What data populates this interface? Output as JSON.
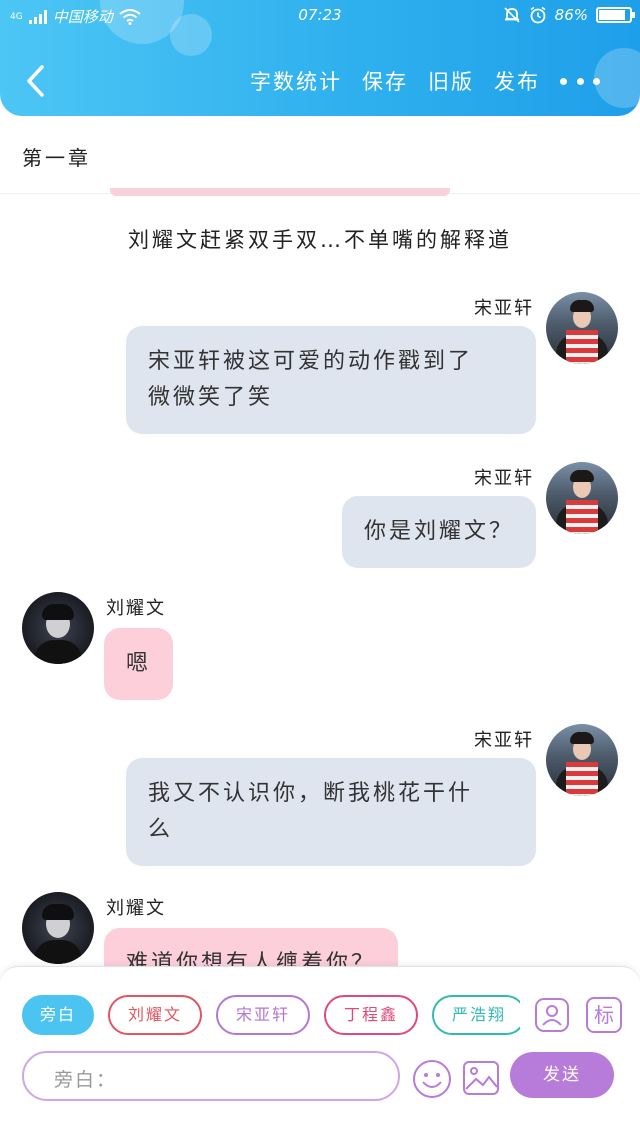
{
  "status_bar": {
    "network": "4G",
    "carrier": "中国移动",
    "time": "07:23",
    "battery_text": "86%",
    "battery_level": 0.86
  },
  "header": {
    "back_icon": "chevron-left-icon",
    "actions": [
      "字数统计",
      "保存",
      "旧版",
      "发布"
    ],
    "more_icon": "more-dots-icon",
    "gradient": [
      "#4cc6f4",
      "#1e9fe9"
    ]
  },
  "chapter": {
    "title": "第一章"
  },
  "messages": {
    "narration": "刘耀文赶紧双手双…不单嘴的解释道",
    "m1": {
      "speaker": "宋亚轩",
      "text": [
        "宋亚轩被这可爱的动作戳到了",
        "微微笑了笑"
      ]
    },
    "m2": {
      "speaker": "宋亚轩",
      "text": [
        "你是刘耀文？"
      ]
    },
    "m3": {
      "speaker": "刘耀文",
      "text": [
        "嗯"
      ]
    },
    "m4": {
      "speaker": "宋亚轩",
      "text": [
        "我又不认识你，断我桃花干什",
        "么"
      ]
    },
    "m5": {
      "speaker": "刘耀文",
      "text": [
        "难道你想有人缠着你？"
      ]
    }
  },
  "composer": {
    "roles": [
      "旁白",
      "刘耀文",
      "宋亚轩",
      "丁程鑫",
      "严浩翔"
    ],
    "active_role": "旁白",
    "input_placeholder": "旁白：",
    "mark_icon_label": "标",
    "send_label": "发送",
    "colors": {
      "accent": "#4cc4f2",
      "send": "#b77bd9",
      "gray_bubble": "#dfe5ee",
      "pink_bubble": "#fccfdb"
    }
  }
}
